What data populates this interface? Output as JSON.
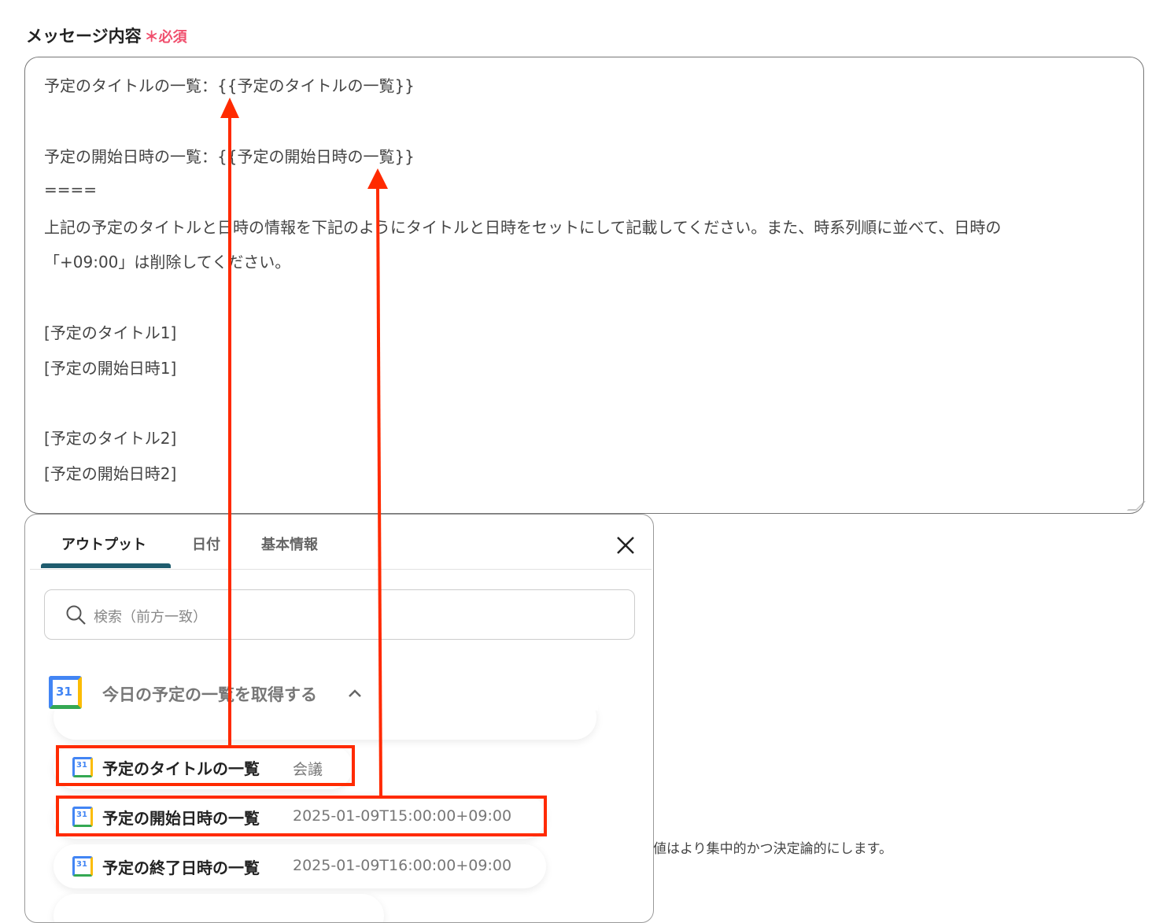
{
  "field": {
    "label": "メッセージ内容",
    "required_mark": "＊",
    "required_text": "必須"
  },
  "message_lines": [
    "予定のタイトルの一覧：{{予定のタイトルの一覧}}",
    "予定の開始日時の一覧：{{予定の開始日時の一覧}}",
    "====",
    "上記の予定のタイトルと日時の情報を下記のようにタイトルと日時をセットにして記載してください。また、時系列順に並べて、日時の",
    "「+09:00」は削除してください。",
    "[予定のタイトル1]",
    "[予定の開始日時1]",
    "[予定のタイトル2]",
    "[予定の開始日時2]"
  ],
  "hint": "値はより集中的かつ決定論的にします。",
  "panel": {
    "tabs": [
      "アウトプット",
      "日付",
      "基本情報"
    ],
    "search_placeholder": "検索（前方一致）",
    "group_title": "今日の予定の一覧を取得する",
    "calendar_icon_text": "31",
    "items": [
      {
        "name": "予定のタイトルの一覧",
        "value": "会議"
      },
      {
        "name": "予定の開始日時の一覧",
        "value": "2025-01-09T15:00:00+09:00"
      },
      {
        "name": "予定の終了日時の一覧",
        "value": "2025-01-09T16:00:00+09:00"
      }
    ]
  },
  "colors": {
    "annotation": "#ff2a00",
    "accent": "#1f5c6e",
    "required": "#f0506e"
  }
}
